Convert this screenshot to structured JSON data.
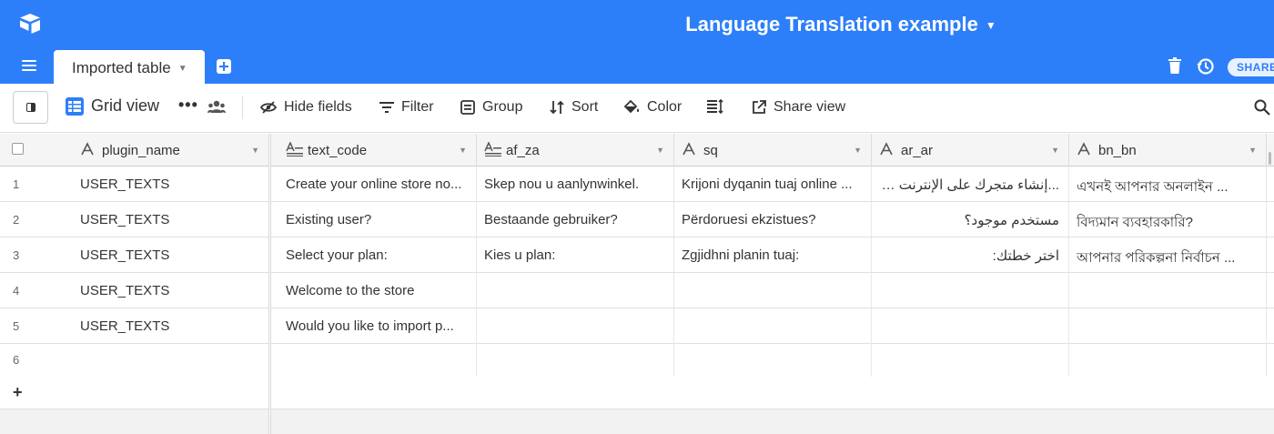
{
  "app": {
    "base_title": "Language Translation example",
    "accent_color": "#2d7ff9"
  },
  "topbar": {
    "table_tab": "Imported table",
    "share_label": "SHARE"
  },
  "viewbar": {
    "view_name": "Grid view",
    "more": "•••",
    "hide_fields": "Hide fields",
    "filter": "Filter",
    "group": "Group",
    "sort": "Sort",
    "color": "Color",
    "share_view": "Share view"
  },
  "grid": {
    "columns": [
      {
        "name": "plugin_name",
        "icon": "text-icon"
      },
      {
        "name": "text_code",
        "icon": "long-text-icon"
      },
      {
        "name": "af_za",
        "icon": "long-text-icon"
      },
      {
        "name": "sq",
        "icon": "text-icon"
      },
      {
        "name": "ar_ar",
        "icon": "text-icon"
      },
      {
        "name": "bn_bn",
        "icon": "text-icon"
      }
    ],
    "rows": [
      {
        "n": "1",
        "cells": [
          "USER_TEXTS",
          "Create your online store no...",
          "Skep nou u aanlynwinkel.",
          "Krijoni dyqanin tuaj online ...",
          "...إنشاء متجرك على الإنترنت الآن",
          "এখনই আপনার অনলাইন ..."
        ]
      },
      {
        "n": "2",
        "cells": [
          "USER_TEXTS",
          "Existing user?",
          "Bestaande gebruiker?",
          "Përdoruesi ekzistues?",
          "مستخدم موجود؟",
          "বিদ্যমান ব্যবহারকারি?"
        ]
      },
      {
        "n": "3",
        "cells": [
          "USER_TEXTS",
          "Select your plan:",
          "Kies u plan:",
          "Zgjidhni planin tuaj:",
          "اختر خطتك:",
          "আপনার পরিকল্পনা নির্বাচন ..."
        ]
      },
      {
        "n": "4",
        "cells": [
          "USER_TEXTS",
          "Welcome to the store",
          "",
          "",
          "",
          ""
        ]
      },
      {
        "n": "5",
        "cells": [
          "USER_TEXTS",
          "Would you like to import p...",
          "",
          "",
          "",
          ""
        ]
      },
      {
        "n": "6",
        "cells": [
          "",
          "",
          "",
          "",
          "",
          ""
        ]
      }
    ],
    "add_row": "+"
  }
}
